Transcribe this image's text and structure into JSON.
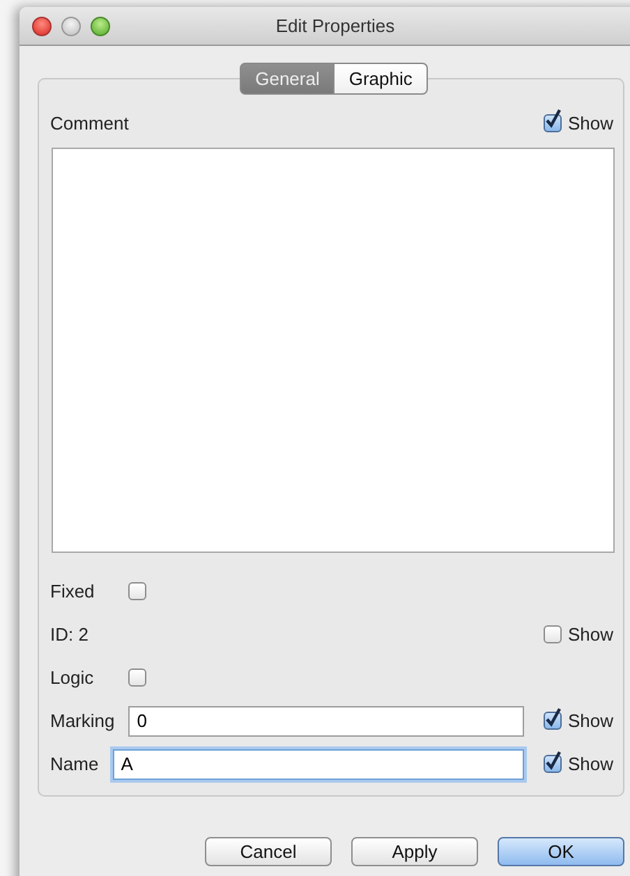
{
  "window": {
    "title": "Edit Properties"
  },
  "tabs": [
    {
      "label": "General",
      "selected": true
    },
    {
      "label": "Graphic",
      "selected": false
    }
  ],
  "comment": {
    "label": "Comment",
    "show": {
      "label": "Show",
      "checked": true
    }
  },
  "rows": [
    {
      "kind": "checkbox",
      "label": "Fixed",
      "checked": false
    },
    {
      "kind": "text",
      "label": "ID: 2",
      "show": {
        "label": "Show",
        "checked": false
      }
    },
    {
      "kind": "checkbox",
      "label": "Logic",
      "checked": false
    },
    {
      "kind": "field",
      "label": "Marking",
      "value": "0",
      "focused": false,
      "show": {
        "label": "Show",
        "checked": true
      }
    },
    {
      "kind": "field",
      "label": "Name",
      "value": "A",
      "focused": true,
      "show": {
        "label": "Show",
        "checked": true
      }
    }
  ],
  "buttons": [
    {
      "label": "Cancel",
      "default": false
    },
    {
      "label": "Apply",
      "default": false
    },
    {
      "label": "OK",
      "default": true
    }
  ]
}
